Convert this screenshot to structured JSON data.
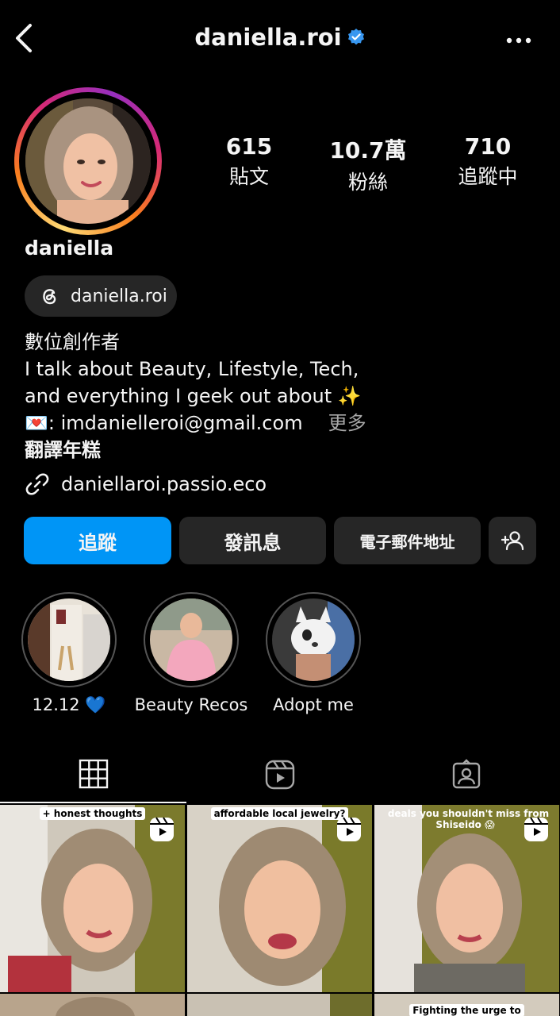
{
  "header": {
    "username": "daniella.roi",
    "verified": true,
    "back_icon": "chevron-left-icon",
    "more_icon": "more-horizontal-icon"
  },
  "profile": {
    "display_name": "daniella",
    "stats": [
      {
        "value": "615",
        "label": "貼文"
      },
      {
        "value": "10.7萬",
        "label": "粉絲"
      },
      {
        "value": "710",
        "label": "追蹤中"
      }
    ],
    "threads_handle": "daniella.roi",
    "bio": {
      "category": "數位創作者",
      "line1": "I talk about Beauty, Lifestyle, Tech,",
      "line2": "and everything I geek out about ✨",
      "line3": "💌: imdanielleroi@gmail.com",
      "more": "更多",
      "translate": "翻譯年糕"
    },
    "link": "daniellaroi.passio.eco"
  },
  "actions": {
    "follow": "追蹤",
    "message": "發訊息",
    "email": "電子郵件地址",
    "suggest_icon": "add-person-icon"
  },
  "highlights": [
    {
      "label": "12.12 💙"
    },
    {
      "label": "Beauty Recos"
    },
    {
      "label": "Adopt me"
    }
  ],
  "tabs": [
    {
      "name": "grid",
      "icon": "grid-icon",
      "active": true
    },
    {
      "name": "reels",
      "icon": "reels-icon",
      "active": false
    },
    {
      "name": "tagged",
      "icon": "tagged-person-icon",
      "active": false
    }
  ],
  "posts": [
    {
      "caption": "+ honest thoughts"
    },
    {
      "caption": "affordable local jewelry?"
    },
    {
      "caption": "deals you shouldn't miss from Shiseido 😱"
    },
    {
      "caption": ""
    },
    {
      "caption": ""
    },
    {
      "caption": "Fighting the urge to"
    }
  ],
  "colors": {
    "accent_blue": "#0095f6",
    "button_gray": "#262626",
    "muted_text": "#a8a8a8",
    "background": "#000000"
  }
}
